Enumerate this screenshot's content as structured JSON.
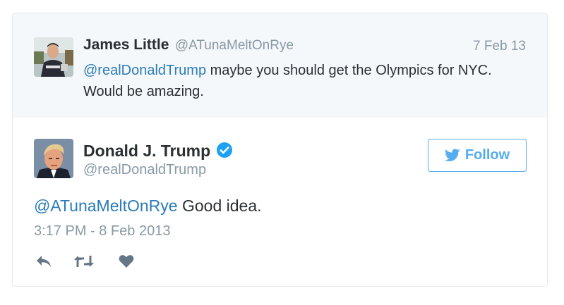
{
  "parent_tweet": {
    "name": "James Little",
    "handle": "@ATunaMeltOnRye",
    "date": "7 Feb 13",
    "mention": "@realDonaldTrump",
    "text": " maybe you should get the Olympics for NYC. Would be amazing."
  },
  "main_tweet": {
    "name": "Donald J. Trump",
    "handle": "@realDonaldTrump",
    "verified_icon": "verified-badge-icon",
    "follow_label": "Follow",
    "mention": "@ATunaMeltOnRye",
    "text": " Good idea.",
    "timestamp": "3:17 PM - 8 Feb 2013"
  },
  "actions": [
    {
      "icon": "reply-icon"
    },
    {
      "icon": "retweet-icon"
    },
    {
      "icon": "like-icon"
    }
  ],
  "colors": {
    "link": "#2b7bb9",
    "follow_accent": "#55acee",
    "muted": "#8899a6",
    "text": "#292f33",
    "parent_background": "#f5f8fa",
    "action_icon": "#657786"
  }
}
